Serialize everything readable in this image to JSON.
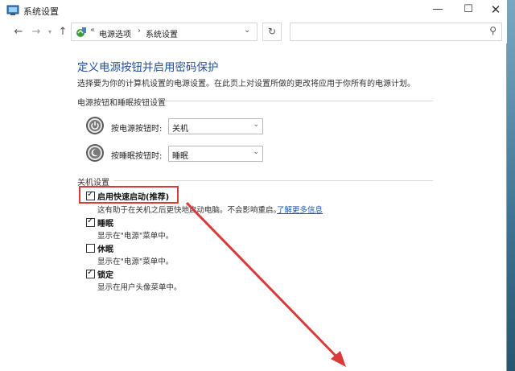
{
  "window": {
    "title": "系统设置",
    "controls": {
      "minimize": "—",
      "maximize": "☐",
      "close": "✕"
    }
  },
  "address": {
    "chevron": "«",
    "crumbs": [
      "电源选项",
      "系统设置"
    ],
    "separator": "›"
  },
  "content": {
    "heading": "定义电源按钮并启用密码保护",
    "description": "选择要为你的计算机设置的电源设置。在此页上对设置所做的更改将应用于你所有的电源计划。",
    "power_group": {
      "title": "电源按钮和睡眠按钮设置",
      "rows": [
        {
          "label": "按电源按钮时:",
          "value": "关机"
        },
        {
          "label": "按睡眠按钮时:",
          "value": "睡眠"
        }
      ]
    },
    "shutdown_group": {
      "title": "关机设置",
      "options": [
        {
          "label": "启用快速启动(推荐)",
          "checked": true,
          "desc": "这有助于在关机之后更快地启动电脑。不会影响重启。",
          "link": "了解更多信息"
        },
        {
          "label": "睡眠",
          "checked": true,
          "desc": "显示在\"电源\"菜单中。"
        },
        {
          "label": "休眠",
          "checked": false,
          "desc": "显示在\"电源\"菜单中。"
        },
        {
          "label": "锁定",
          "checked": true,
          "desc": "显示在用户头像菜单中。"
        }
      ]
    }
  },
  "annotation": {
    "color": "#d93a3a"
  },
  "colors": {
    "heading": "#1f4e9a",
    "link": "#1a55b5"
  }
}
